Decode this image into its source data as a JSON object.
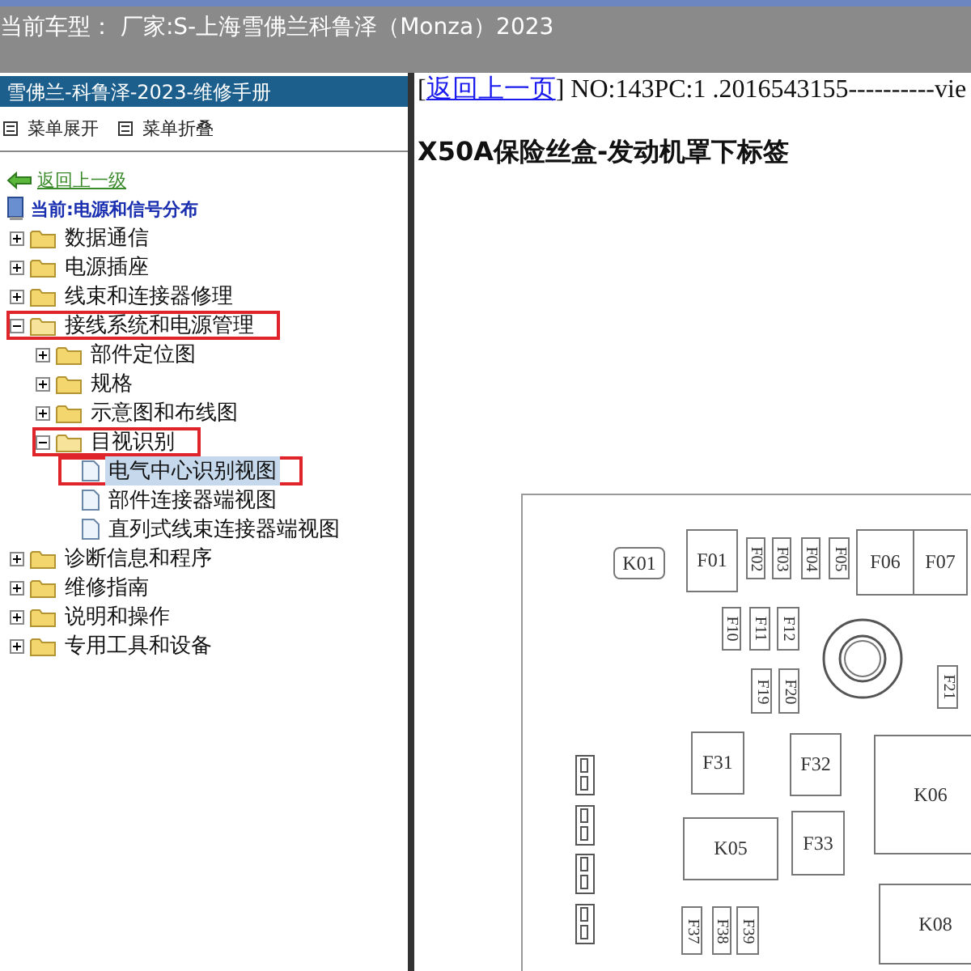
{
  "title_bar": {
    "text": "当前车型： 厂家:S-上海雪佛兰科鲁泽（Monza）2023"
  },
  "sidebar": {
    "title": "雪佛兰-科鲁泽-2023-维修手册",
    "menu_buttons": [
      "菜单展开",
      "菜单折叠"
    ],
    "back_link": "返回上一级",
    "current": "当前:电源和信号分布",
    "tree": [
      {
        "label": "数据通信",
        "kind": "folder",
        "expanded": false,
        "outlined": false
      },
      {
        "label": "电源插座",
        "kind": "folder",
        "expanded": false,
        "outlined": false
      },
      {
        "label": "线束和连接器修理",
        "kind": "folder",
        "expanded": false,
        "outlined": false
      },
      {
        "label": "接线系统和电源管理",
        "kind": "folder",
        "expanded": true,
        "outlined": true,
        "children": [
          {
            "label": "部件定位图",
            "kind": "folder",
            "expanded": false,
            "outlined": false
          },
          {
            "label": "规格",
            "kind": "folder",
            "expanded": false,
            "outlined": false
          },
          {
            "label": "示意图和布线图",
            "kind": "folder",
            "expanded": false,
            "outlined": false
          },
          {
            "label": "目视识别",
            "kind": "folder",
            "expanded": true,
            "outlined": true,
            "children": [
              {
                "label": "电气中心识别视图",
                "kind": "page",
                "selected": true,
                "outlined": true
              },
              {
                "label": "部件连接器端视图",
                "kind": "page",
                "selected": false,
                "outlined": false
              },
              {
                "label": "直列式线束连接器端视图",
                "kind": "page",
                "selected": false,
                "outlined": false
              }
            ]
          }
        ]
      },
      {
        "label": "诊断信息和程序",
        "kind": "folder",
        "expanded": false,
        "outlined": false
      },
      {
        "label": "维修指南",
        "kind": "folder",
        "expanded": false,
        "outlined": false
      },
      {
        "label": "说明和操作",
        "kind": "folder",
        "expanded": false,
        "outlined": false
      },
      {
        "label": "专用工具和设备",
        "kind": "folder",
        "expanded": false,
        "outlined": false
      }
    ]
  },
  "content": {
    "open_bracket": "[",
    "back_link": "返回上一页",
    "info": "] NO:143PC:1 .2016543155----------vie",
    "heading": "X50A保险丝盒-发动机罩下标签",
    "fuse_box": [
      {
        "label": "K01",
        "kind": "relay-tag"
      },
      {
        "label": "F01",
        "kind": "block"
      },
      {
        "label": "F02",
        "kind": "mini"
      },
      {
        "label": "F03",
        "kind": "mini"
      },
      {
        "label": "F04",
        "kind": "mini"
      },
      {
        "label": "F05",
        "kind": "mini"
      },
      {
        "label": "F06",
        "kind": "block"
      },
      {
        "label": "F07",
        "kind": "block"
      },
      {
        "label": "F10",
        "kind": "mini"
      },
      {
        "label": "F11",
        "kind": "mini"
      },
      {
        "label": "F12",
        "kind": "mini"
      },
      {
        "label": "F19",
        "kind": "mini"
      },
      {
        "label": "F20",
        "kind": "mini"
      },
      {
        "label": "F21",
        "kind": "mini"
      },
      {
        "label": "F31",
        "kind": "block"
      },
      {
        "label": "F32",
        "kind": "block"
      },
      {
        "label": "K06",
        "kind": "block"
      },
      {
        "label": "K05",
        "kind": "block"
      },
      {
        "label": "F33",
        "kind": "block"
      },
      {
        "label": "F37",
        "kind": "mini"
      },
      {
        "label": "F38",
        "kind": "mini"
      },
      {
        "label": "F39",
        "kind": "mini"
      },
      {
        "label": "K08",
        "kind": "block"
      }
    ]
  }
}
